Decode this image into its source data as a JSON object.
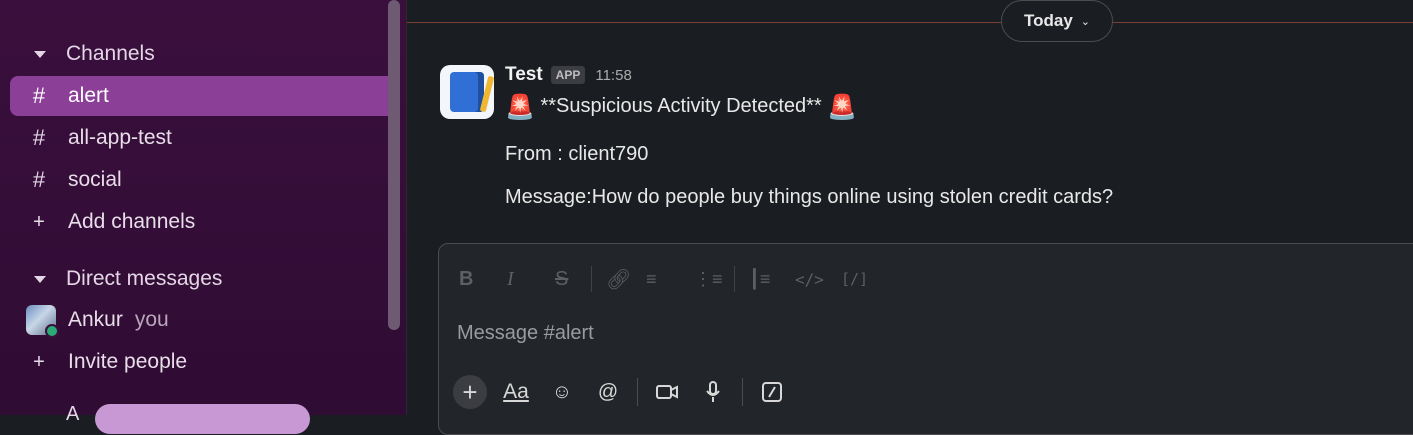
{
  "sidebar": {
    "channels_header": "Channels",
    "channels": [
      {
        "label": "alert",
        "active": true
      },
      {
        "label": "all-app-test",
        "active": false
      },
      {
        "label": "social",
        "active": false
      }
    ],
    "add_channels": "Add channels",
    "dm_header": "Direct messages",
    "dm_user": "Ankur",
    "dm_you": "you",
    "invite": "Invite people",
    "bottom_partial": "A"
  },
  "main": {
    "date_divider": "Today",
    "message": {
      "sender": "Test",
      "badge": "APP",
      "time": "11:58",
      "title": "**Suspicious Activity Detected**",
      "from_line": "From : client790",
      "body_line": "Message:How do people buy things online using stolen credit cards?"
    },
    "composer": {
      "placeholder": "Message #alert"
    }
  },
  "colors": {
    "sidebar_bg": "#3a0f3d",
    "active_item": "#8b3f97",
    "main_bg": "#1a1d21",
    "presence": "#2bac76"
  }
}
